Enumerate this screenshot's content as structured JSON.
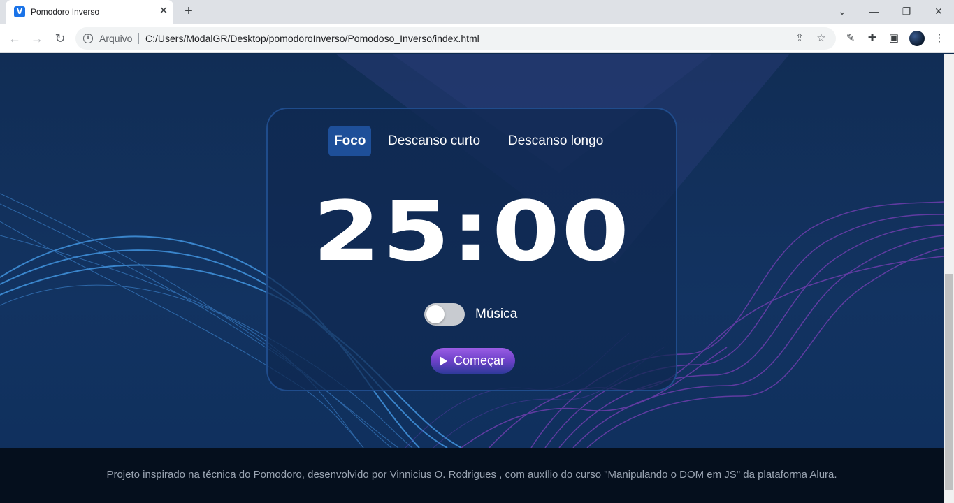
{
  "browser": {
    "tab_title": "Pomodoro Inverso",
    "tab_favicon_letter": "V",
    "address_label": "Arquivo",
    "url": "C:/Users/ModalGR/Desktop/pomodoroInverso/Pomodoso_Inverso/index.html"
  },
  "icons": {
    "back": "arrow-left-icon",
    "forward": "arrow-right-icon",
    "reload": "reload-icon",
    "info": "info-icon",
    "share": "share-icon",
    "bookmark": "star-icon",
    "eyedropper": "eyedropper-icon",
    "extensions": "puzzle-icon",
    "side_panel": "side-panel-icon",
    "menu": "kebab-menu-icon",
    "play": "play-icon"
  },
  "app": {
    "modes": [
      {
        "label": "Foco",
        "active": true
      },
      {
        "label": "Descanso curto",
        "active": false
      },
      {
        "label": "Descanso longo",
        "active": false
      }
    ],
    "timer": "25:00",
    "music_label": "Música",
    "music_on": false,
    "start_label": "Começar"
  },
  "footer": {
    "text": "Projeto inspirado na técnica do Pomodoro, desenvolvido por Vinnicius O. Rodrigues , com auxílio do curso \"Manipulando o DOM em JS\" da plataforma Alura."
  },
  "colors": {
    "active_tab": "#1e4f99",
    "card_border": "#235296",
    "start_gradient_top": "#9b5de5",
    "start_gradient_bottom": "#2f3a9a",
    "footer_bg": "#050f1d"
  }
}
